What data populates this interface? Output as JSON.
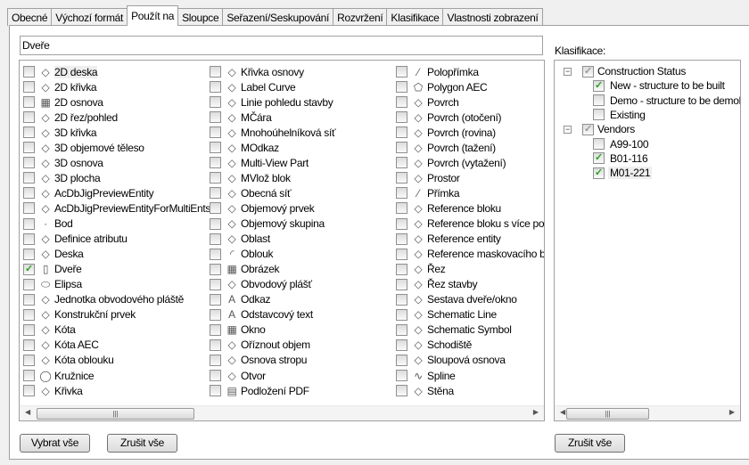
{
  "tabs": [
    {
      "label": "Obecné"
    },
    {
      "label": "Výchozí formát"
    },
    {
      "label": "Použít na",
      "active": true
    },
    {
      "label": "Sloupce"
    },
    {
      "label": "Seřazení/Seskupování"
    },
    {
      "label": "Rozvržení"
    },
    {
      "label": "Klasifikace"
    },
    {
      "label": "Vlastnosti zobrazení"
    }
  ],
  "filter": {
    "value": "Dveře"
  },
  "objects": [
    [
      {
        "label": "2D deska",
        "icon": "slab-2d-icon",
        "checked": false,
        "selected": true
      },
      {
        "label": "2D křivka",
        "icon": "polyline-2d-icon",
        "checked": false
      },
      {
        "label": "2D osnova",
        "icon": "grid-2d-icon",
        "checked": false
      },
      {
        "label": "2D řez/pohled",
        "icon": "section-2d-icon",
        "checked": false
      },
      {
        "label": "3D křivka",
        "icon": "polyline-3d-icon",
        "checked": false
      },
      {
        "label": "3D objemové těleso",
        "icon": "solid-3d-icon",
        "checked": false
      },
      {
        "label": "3D osnova",
        "icon": "grid-3d-icon",
        "checked": false
      },
      {
        "label": "3D plocha",
        "icon": "face-3d-icon",
        "checked": false
      },
      {
        "label": "AcDbJigPreviewEntity",
        "icon": "entity-icon",
        "checked": false
      },
      {
        "label": "AcDbJigPreviewEntityForMultiEnts",
        "icon": "entity-icon",
        "checked": false
      },
      {
        "label": "Bod",
        "icon": "point-icon",
        "checked": false
      },
      {
        "label": "Definice atributu",
        "icon": "attribute-tag-icon",
        "checked": false
      },
      {
        "label": "Deska",
        "icon": "slab-icon",
        "checked": false
      },
      {
        "label": "Dveře",
        "icon": "door-icon",
        "checked": true
      },
      {
        "label": "Elipsa",
        "icon": "ellipse-icon",
        "checked": false
      },
      {
        "label": "Jednotka obvodového pláště",
        "icon": "curtain-wall-unit-icon",
        "checked": false
      },
      {
        "label": "Konstrukční prvek",
        "icon": "structural-member-icon",
        "checked": false
      },
      {
        "label": "Kóta",
        "icon": "dimension-icon",
        "checked": false
      },
      {
        "label": "Kóta AEC",
        "icon": "aec-dimension-icon",
        "checked": false
      },
      {
        "label": "Kóta oblouku",
        "icon": "arc-dimension-icon",
        "checked": false
      },
      {
        "label": "Kružnice",
        "icon": "circle-icon",
        "checked": false
      },
      {
        "label": "Křivka",
        "icon": "polyline-icon",
        "checked": false
      }
    ],
    [
      {
        "label": "Křivka osnovy",
        "icon": "grid-curve-icon",
        "checked": false
      },
      {
        "label": "Label Curve",
        "icon": "label-curve-icon",
        "checked": false
      },
      {
        "label": "Linie pohledu stavby",
        "icon": "building-elevation-line-icon",
        "checked": false
      },
      {
        "label": "MČára",
        "icon": "mline-icon",
        "checked": false
      },
      {
        "label": "Mnohoúhelníková síť",
        "icon": "polyface-mesh-icon",
        "checked": false
      },
      {
        "label": "MOdkaz",
        "icon": "mleader-icon",
        "checked": false
      },
      {
        "label": "Multi-View Part",
        "icon": "mvpart-icon",
        "checked": false
      },
      {
        "label": "MVlož blok",
        "icon": "minsert-block-icon",
        "checked": false
      },
      {
        "label": "Obecná síť",
        "icon": "mesh-icon",
        "checked": false
      },
      {
        "label": "Objemový prvek",
        "icon": "mass-element-icon",
        "checked": false
      },
      {
        "label": "Objemový skupina",
        "icon": "mass-group-icon",
        "checked": false
      },
      {
        "label": "Oblast",
        "icon": "region-icon",
        "checked": false
      },
      {
        "label": "Oblouk",
        "icon": "arc-icon",
        "checked": false
      },
      {
        "label": "Obrázek",
        "icon": "image-icon",
        "checked": false
      },
      {
        "label": "Obvodový plášť",
        "icon": "curtain-wall-icon",
        "checked": false
      },
      {
        "label": "Odkaz",
        "icon": "leader-icon",
        "checked": false
      },
      {
        "label": "Odstavcový text",
        "icon": "mtext-icon",
        "checked": false
      },
      {
        "label": "Okno",
        "icon": "window-icon",
        "checked": false
      },
      {
        "label": "Oříznout objem",
        "icon": "clip-volume-icon",
        "checked": false
      },
      {
        "label": "Osnova stropu",
        "icon": "ceiling-grid-icon",
        "checked": false
      },
      {
        "label": "Otvor",
        "icon": "opening-icon",
        "checked": false
      },
      {
        "label": "Podložení PDF",
        "icon": "pdf-underlay-icon",
        "checked": false
      }
    ],
    [
      {
        "label": "Polopřímka",
        "icon": "ray-icon",
        "checked": false
      },
      {
        "label": "Polygon AEC",
        "icon": "polygon-icon",
        "checked": false
      },
      {
        "label": "Povrch",
        "icon": "surface-icon",
        "checked": false
      },
      {
        "label": "Povrch (otočení)",
        "icon": "revolved-surface-icon",
        "checked": false
      },
      {
        "label": "Povrch (rovina)",
        "icon": "planar-surface-icon",
        "checked": false
      },
      {
        "label": "Povrch (tažení)",
        "icon": "swept-surface-icon",
        "checked": false
      },
      {
        "label": "Povrch (vytažení)",
        "icon": "extruded-surface-icon",
        "checked": false
      },
      {
        "label": "Prostor",
        "icon": "space-icon",
        "checked": false
      },
      {
        "label": "Přímka",
        "icon": "xline-icon",
        "checked": false
      },
      {
        "label": "Reference bloku",
        "icon": "block-reference-icon",
        "checked": false
      },
      {
        "label": "Reference bloku s více pohledy",
        "icon": "mv-block-reference-icon",
        "checked": false
      },
      {
        "label": "Reference entity",
        "icon": "entity-reference-icon",
        "checked": false
      },
      {
        "label": "Reference maskovacího bloku",
        "icon": "mask-block-icon",
        "checked": false
      },
      {
        "label": "Řez",
        "icon": "section-icon",
        "checked": false
      },
      {
        "label": "Řez stavby",
        "icon": "building-section-icon",
        "checked": false
      },
      {
        "label": "Sestava dveře/okno",
        "icon": "door-window-assembly-icon",
        "checked": false
      },
      {
        "label": "Schematic Line",
        "icon": "schematic-line-icon",
        "checked": false
      },
      {
        "label": "Schematic Symbol",
        "icon": "schematic-symbol-icon",
        "checked": false
      },
      {
        "label": "Schodiště",
        "icon": "stair-icon",
        "checked": false
      },
      {
        "label": "Sloupová osnova",
        "icon": "column-grid-icon",
        "checked": false
      },
      {
        "label": "Spline",
        "icon": "spline-icon",
        "checked": false
      },
      {
        "label": "Stěna",
        "icon": "wall-icon",
        "checked": false
      }
    ]
  ],
  "buttons": {
    "select_all": "Vybrat vše",
    "clear_all": "Zrušit vše",
    "clear_all_right": "Zrušit vše"
  },
  "classification": {
    "label": "Klasifikace:",
    "groups": [
      {
        "name": "Construction Status",
        "items": [
          {
            "label": "New - structure to be built",
            "checked": true
          },
          {
            "label": "Demo - structure to be demolished",
            "checked": false
          },
          {
            "label": "Existing",
            "checked": false
          }
        ]
      },
      {
        "name": "Vendors",
        "items": [
          {
            "label": "A99-100",
            "checked": false
          },
          {
            "label": "B01-116",
            "checked": true
          },
          {
            "label": "M01-221",
            "checked": true,
            "selected": true
          }
        ]
      }
    ]
  },
  "colors": {
    "check": "#2a9d1f",
    "border": "#a0a0a0"
  }
}
